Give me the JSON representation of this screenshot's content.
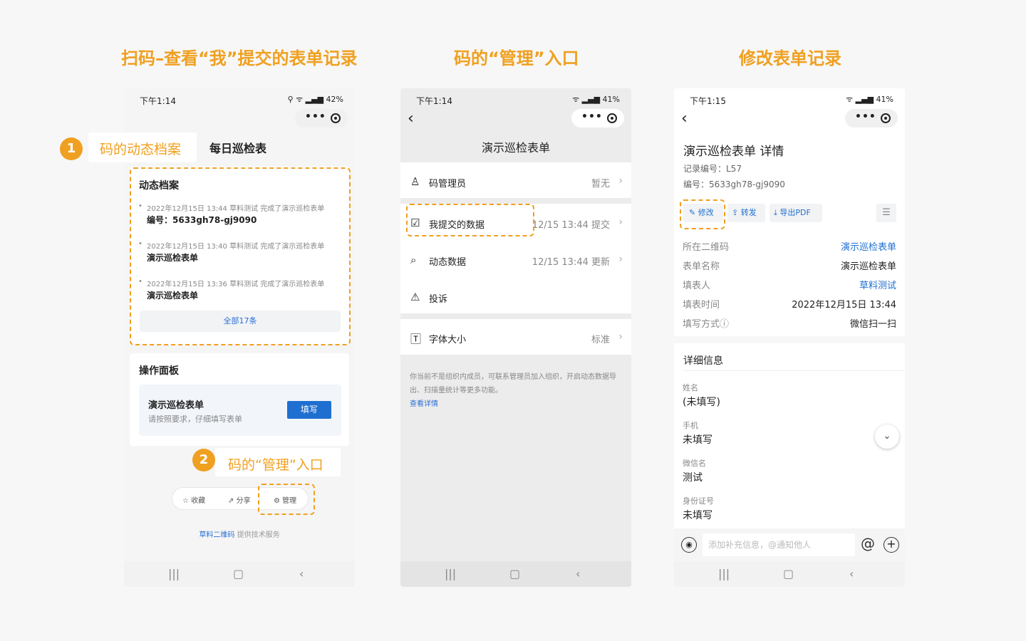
{
  "headings": [
    "扫码–查看“我”提交的表单记录",
    "码的“管理”入口",
    "修改表单记录"
  ],
  "phone1": {
    "time": "下午1:14",
    "status_right": "⚲ ᯤ ▂▄▆ 42%",
    "tab_active": "码的动态档案",
    "tab_other": "每日巡检表",
    "badge1": "1",
    "badge2": "2",
    "archive_title": "动态档案",
    "records": [
      {
        "meta": "2022年12月15日 13:44  草料测试 完成了演示巡检表单",
        "main": "编号：5633gh78-gj9090"
      },
      {
        "meta": "2022年12月15日 13:40  草料测试 完成了演示巡检表单",
        "main": "演示巡检表单"
      },
      {
        "meta": "2022年12月15日 13:36  草料测试 完成了演示巡检表单",
        "main": "演示巡检表单"
      }
    ],
    "all_label": "全部17条",
    "panel_title": "操作面板",
    "form_name": "演示巡检表单",
    "form_hint": "请按照要求，仔细填写表单",
    "fill_label": "填写",
    "manage_hint": "码的“管理”入口",
    "actions": [
      "收藏",
      "分享",
      "管理"
    ],
    "footer_brand": "草料二维码",
    "footer_rest": " 提供技术服务"
  },
  "phone2": {
    "time": "下午1:14",
    "status_right": "ᯤ ▂▄▆ 41%",
    "title": "演示巡检表单",
    "rows": [
      {
        "label": "码管理员",
        "value": "暂无"
      },
      {
        "label": "我提交的数据",
        "value": "12/15 13:44 提交"
      },
      {
        "label": "动态数据",
        "value": "12/15 13:44 更新"
      },
      {
        "label": "投诉",
        "value": ""
      },
      {
        "label": "字体大小",
        "value": "标准"
      }
    ],
    "notice": "你当前不是组织内成员，可联系管理员加入组织，开启动态数据导出、扫描量统计等更多功能。",
    "notice_link": "查看详情"
  },
  "phone3": {
    "time": "下午1:15",
    "status_right": "ᯤ ▂▄▆ 41%",
    "title": "演示巡检表单 详情",
    "record_no": "记录编号：L57",
    "serial_no": "编号：5633gh78-gj9090",
    "buttons": [
      "修改",
      "转发",
      "导出PDF"
    ],
    "info": [
      {
        "k": "所在二维码",
        "v": "演示巡检表单"
      },
      {
        "k": "表单名称",
        "v": "演示巡检表单"
      },
      {
        "k": "填表人",
        "v": "草料测试"
      },
      {
        "k": "填表时间",
        "v": "2022年12月15日 13:44"
      },
      {
        "k": "填写方式ⓘ",
        "v": "微信扫一扫"
      }
    ],
    "detail_title": "详细信息",
    "fields": [
      {
        "label": "姓名",
        "value": "(未填写)"
      },
      {
        "label": "手机",
        "value": "未填写"
      },
      {
        "label": "微信名",
        "value": "测试"
      },
      {
        "label": "身份证号",
        "value": "未填写"
      }
    ],
    "input_placeholder": "添加补充信息，@通知他人",
    "at_icon": "@",
    "plus_icon": "+"
  },
  "colors": {
    "accent": "#f0a020",
    "link": "#2a6fd6",
    "button": "#1f6fd1"
  }
}
